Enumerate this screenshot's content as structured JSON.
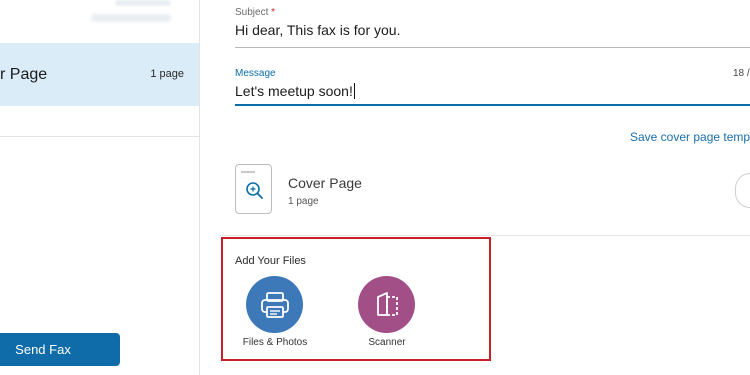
{
  "sidebar": {
    "document": {
      "name": "r Page",
      "pages": "1 page"
    },
    "send_fax_label": "Send Fax"
  },
  "form": {
    "subject": {
      "label": "Subject",
      "required_mark": "*",
      "value": "Hi dear, This fax is for you."
    },
    "message": {
      "label": "Message",
      "value": "Let's meetup soon!",
      "counter": "18 /"
    },
    "save_cover_link": "Save cover page temp"
  },
  "cover_page": {
    "title": "Cover Page",
    "pages": "1 page"
  },
  "add_files": {
    "title": "Add Your Files",
    "options": [
      {
        "label": "Files & Photos",
        "icon": "printer-icon",
        "color": "#3d79b8"
      },
      {
        "label": "Scanner",
        "icon": "scanner-icon",
        "color": "#a24f88"
      }
    ]
  },
  "colors": {
    "accent": "#0a6ea9",
    "send_button": "#0f6ca8",
    "highlight_border": "#c8202a",
    "selected_item": "#d9ecf7"
  }
}
